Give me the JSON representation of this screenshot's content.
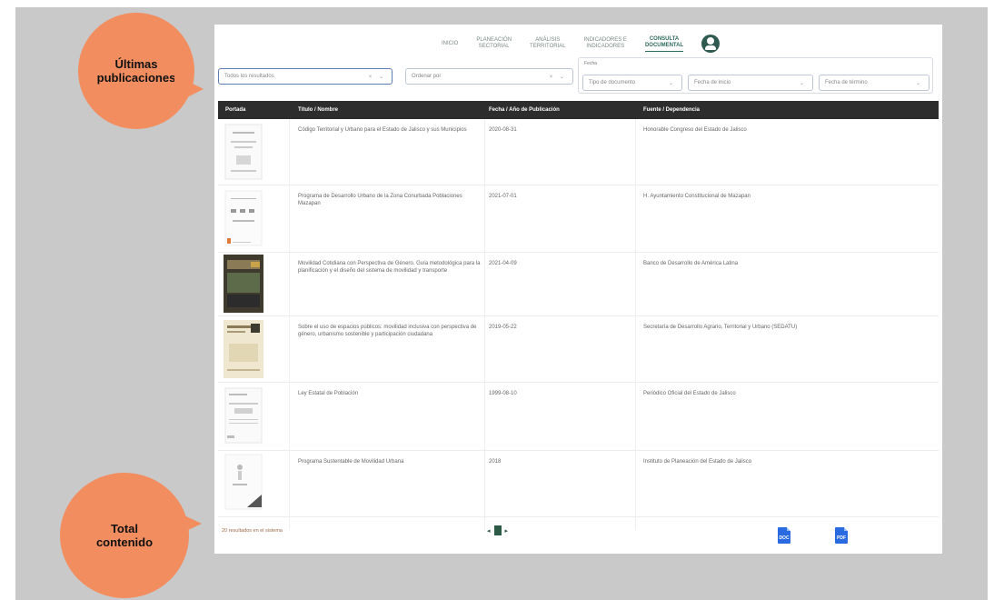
{
  "nav": {
    "items": [
      {
        "label": "INICIO"
      },
      {
        "label": "PLANEACIÓN\nSECTORIAL"
      },
      {
        "label": "ANÁLISIS\nTERRITORIAL"
      },
      {
        "label": "INDICADORES E\nINDICADORES"
      },
      {
        "label": "CONSULTA\nDOCUMENTAL",
        "active": true
      }
    ]
  },
  "filters": {
    "type": {
      "value": "Todos los resultados",
      "controls": "× ⌄"
    },
    "order": {
      "value": "Ordenar por",
      "controls": "× ⌄"
    },
    "date_legend": "Fecha",
    "date_type": {
      "value": "Tipo de documento",
      "controls": "⌄"
    },
    "date_from": {
      "value": "Fecha de inicio",
      "controls": "⌄"
    },
    "date_to": {
      "value": "Fecha de término",
      "controls": "⌄"
    }
  },
  "table": {
    "headers": [
      "Portada",
      "Título / Nombre",
      "Fecha / Año de Publicación",
      "Fuente / Dependencia"
    ],
    "rows": [
      {
        "title": "Código Territorial y Urbano para el Estado de Jalisco y sus Municipios",
        "date": "2020-08-31",
        "source": "Honorable Congreso del Estado de Jalisco"
      },
      {
        "title": "Programa de Desarrollo Urbano de la Zona Conurbada Poblaciones Mazapan",
        "date": "2021-07-01",
        "source": "H. Ayuntamiento Constitucional de Mazapan"
      },
      {
        "title": "Movilidad Cotidiana con Perspectiva de Género. Guía metodológica para la planificación y el diseño del sistema de movilidad y transporte",
        "date": "2021-04-09",
        "source": "Banco de Desarrollo de América Latina"
      },
      {
        "title": "Sobre el uso de espacios públicos: movilidad inclusiva con perspectiva de género, urbanismo sostenible y participación ciudadana",
        "date": "2019-05-22",
        "source": "Secretaría de Desarrollo Agrario, Territorial y Urbano (SEDATU)"
      },
      {
        "title": "Ley Estatal de Población",
        "date": "1999-08-10",
        "source": "Periódico Oficial del Estado de Jalisco"
      },
      {
        "title": "Programa Sustentable de Movilidad Urbana",
        "date": "2018",
        "source": "Instituto de Planeación del Estado de Jalisco"
      }
    ]
  },
  "footer": {
    "count_text": "20 resultados en el sistema",
    "pager_prev": "◂",
    "pager_next": "▸",
    "pager_current": "1",
    "export_word": "DOC",
    "export_pdf": "PDF"
  },
  "callouts": {
    "top": "Últimas\npublicaciones",
    "bottom": "Total\ncontenido"
  },
  "colors": {
    "accent": "#2f6b5c",
    "callout": "#f28d60",
    "header_bg": "#2d2d2d",
    "export_icon": "#2a6ae0"
  }
}
